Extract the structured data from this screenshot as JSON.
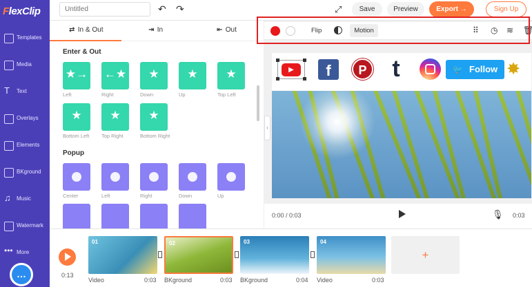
{
  "app": {
    "logo_prefix": "F",
    "logo_rest": "lexClip"
  },
  "sidebar": {
    "items": [
      {
        "label": "Templates"
      },
      {
        "label": "Media"
      },
      {
        "label": "Text"
      },
      {
        "label": "Overlays"
      },
      {
        "label": "Elements"
      },
      {
        "label": "BKground"
      },
      {
        "label": "Music"
      },
      {
        "label": "Watermark"
      },
      {
        "label": "More"
      }
    ]
  },
  "topbar": {
    "title_placeholder": "Untitled",
    "save": "Save",
    "preview": "Preview",
    "export": "Export →",
    "signup": "Sign Up"
  },
  "panel": {
    "tabs": [
      {
        "label": "In & Out"
      },
      {
        "label": "In"
      },
      {
        "label": "Out"
      }
    ],
    "section1": "Enter & Out",
    "enter_out": [
      "Left",
      "Right",
      "Down",
      "Up",
      "Top Left",
      "Bottom Left",
      "Top Right",
      "Bottom Right"
    ],
    "section2": "Popup",
    "popup": [
      "Center",
      "Left",
      "Right",
      "Down",
      "Up"
    ]
  },
  "toolbar": {
    "flip": "Flip",
    "motion": "Motion",
    "primary_color": "#e8191a",
    "secondary_color": "#ffffff"
  },
  "canvas": {
    "twitter_label": "Follow",
    "pinterest_letter": "P",
    "facebook_letter": "f",
    "tumblr_letter": "t"
  },
  "player": {
    "time_current": "0:00 / 0:03",
    "time_total": "0:03"
  },
  "timeline": {
    "total": "0:13",
    "clips": [
      {
        "num": "01",
        "label": "Video",
        "duration": "0:03"
      },
      {
        "num": "02",
        "label": "BKground",
        "duration": "0:03"
      },
      {
        "num": "03",
        "label": "BKground",
        "duration": "0:04"
      },
      {
        "num": "04",
        "label": "Video",
        "duration": "0:03"
      }
    ],
    "add": "+"
  }
}
